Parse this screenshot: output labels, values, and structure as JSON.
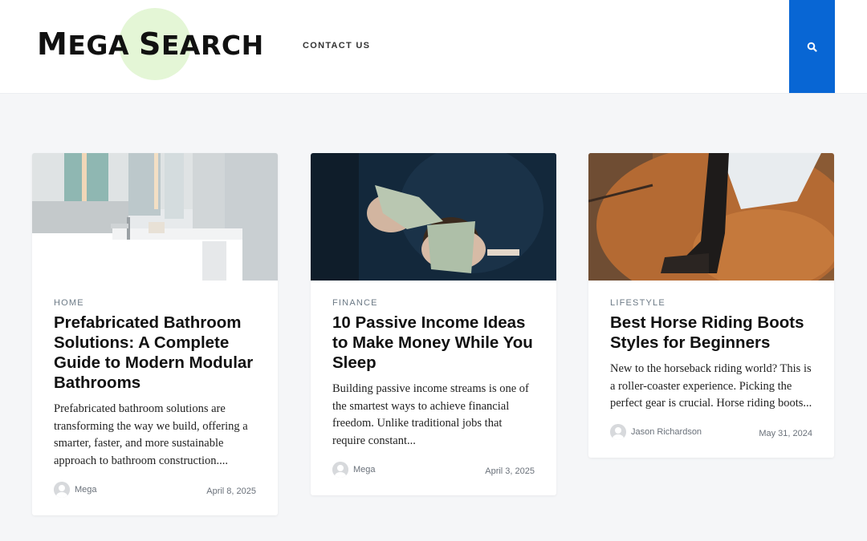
{
  "header": {
    "logo_word1_cap": "M",
    "logo_word1_rest": "ega",
    "logo_word2_cap": "S",
    "logo_word2_rest": "earch",
    "nav_contact": "CONTACT US",
    "search_icon": "search-icon",
    "accent_color": "#0866d4"
  },
  "posts": [
    {
      "category": "HOME",
      "title": "Prefabricated Bathroom Solutions: A Complete Guide to Modern Modular Bathrooms",
      "excerpt": "Prefabricated bathroom solutions are transforming the way we build, offering a smarter, faster, and more sustainable approach to bathroom construction....",
      "author": "Mega",
      "date": "April 8, 2025"
    },
    {
      "category": "FINANCE",
      "title": "10 Passive Income Ideas to Make Money While You Sleep",
      "excerpt": "Building passive income streams is one of the smartest ways to achieve financial freedom. Unlike traditional jobs that require constant...",
      "author": "Mega",
      "date": "April 3, 2025"
    },
    {
      "category": "LIFESTYLE",
      "title": "Best Horse Riding Boots Styles for Beginners",
      "excerpt": "New to the horseback riding world? This is a roller-coaster experience. Picking the perfect gear is crucial. Horse riding boots...",
      "author": "Jason Richardson",
      "date": "May 31, 2024"
    }
  ]
}
